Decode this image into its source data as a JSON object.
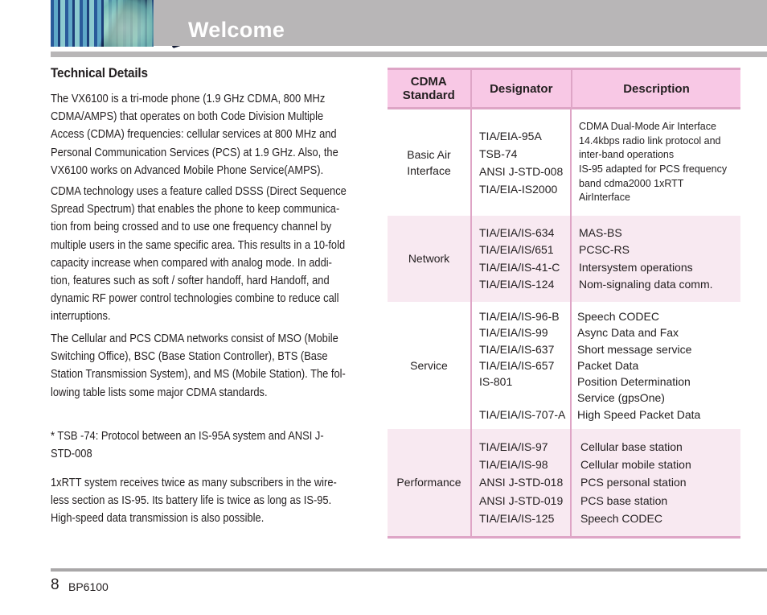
{
  "header": {
    "title": "Welcome",
    "image": "header-photo"
  },
  "content": {
    "section_title": "Technical Details",
    "paragraphs": [
      "The VX6100 is a tri-mode phone (1.9 GHz CDMA, 800 MHz CDMA/AMPS) that operates on both Code Division Multiple Access (CDMA) frequencies: cellular services at 800 MHz and Personal Communication Services (PCS) at 1.9 GHz. Also, the VX6100 works on Advanced Mobile Phone Service(AMPS).",
      "CDMA technology uses a feature called DSSS (Direct Sequence Spread Spectrum) that enables the phone to keep communica-tion from being crossed and to use one frequency channel by multiple users in the same specific area. This results in a 10-fold capacity increase when compared with analog mode. In addi-tion, features such as soft / softer handoff, hard Handoff, and dynamic RF power control technologies combine to reduce call interruptions.",
      "The Cellular and PCS CDMA networks consist of MSO (Mobile Switching Office), BSC (Base Station Controller), BTS (Base Station Transmission System), and MS (Mobile Station). The fol-lowing table lists some major CDMA standards.",
      "*  TSB -74: Protocol between an IS-95A system and ANSI J-STD-008",
      "1xRTT system receives twice as many subscribers in the wire-less section as IS-95. Its battery life is twice as long as IS-95. High-speed data transmission is also possible."
    ],
    "paragraph_lines": [
      [
        "The VX6100 is a tri-mode phone (1.9 GHz CDMA, 800 MHz",
        "CDMA/AMPS) that operates on both Code Division Multiple",
        "Access (CDMA) frequencies: cellular services at 800 MHz and",
        "Personal Communication Services (PCS) at 1.9 GHz. Also, the",
        "VX6100 works on Advanced Mobile Phone Service(AMPS)."
      ],
      [
        "CDMA technology uses a feature called DSSS (Direct Sequence",
        "Spread Spectrum) that enables the phone to keep communica-",
        "tion from being crossed and to use one frequency channel by",
        "multiple users in the same specific area. This results in a 10-fold",
        "capacity increase when compared with analog mode. In addi-",
        "tion, features such as soft / softer handoff, hard Handoff, and",
        "dynamic RF power control technologies combine to reduce call",
        "interruptions."
      ],
      [
        "The Cellular and PCS CDMA networks consist of MSO (Mobile",
        "Switching Office), BSC (Base Station Controller), BTS (Base",
        "Station Transmission System), and MS (Mobile Station). The fol-",
        "lowing table lists some major CDMA standards."
      ],
      [
        "*  TSB -74: Protocol between an IS-95A system and ANSI J-",
        "STD-008"
      ],
      [
        "1xRTT system receives twice as many subscribers in the wire-",
        "less section as IS-95. Its battery life is twice as long as IS-95.",
        "High-speed data transmission is also possible."
      ]
    ]
  },
  "table": {
    "headers": [
      "CDMA Standard",
      "Designator",
      "Description"
    ],
    "header_lines": [
      [
        "CDMA",
        "Standard"
      ],
      [
        "Designator"
      ],
      [
        "Description"
      ]
    ],
    "colors": {
      "header_bg": "#f8c8e5",
      "border": "#dea5c6",
      "alt_row_bg": "#f8e9f1"
    },
    "rows": [
      {
        "standard": [
          "Basic Air",
          "Interface"
        ],
        "designators": [
          "TIA/EIA-95A",
          "TSB-74",
          "ANSI J-STD-008",
          "TIA/EIA-IS2000"
        ],
        "descriptions": [
          "CDMA Dual-Mode Air Interface",
          "14.4kbps radio link protocol and",
          "inter-band operations",
          "IS-95 adapted for PCS frequency",
          "band cdma2000 1xRTT",
          "AirInterface"
        ]
      },
      {
        "standard": [
          "Network"
        ],
        "designators": [
          "TIA/EIA/IS-634",
          "TIA/EIA/IS/651",
          "TIA/EIA/IS-41-C",
          "TIA/EIA/IS-124"
        ],
        "descriptions": [
          "MAS-BS",
          "PCSC-RS",
          "Intersystem operations",
          "Nom-signaling data comm."
        ]
      },
      {
        "standard": [
          "Service"
        ],
        "designators": [
          "TIA/EIA/IS-96-B",
          "TIA/EIA/IS-99",
          "TIA/EIA/IS-637",
          "TIA/EIA/IS-657",
          "IS-801",
          "",
          "TIA/EIA/IS-707-A"
        ],
        "descriptions": [
          "Speech CODEC",
          "Async Data and Fax",
          "Short message service",
          "Packet Data",
          "Position Determination",
          "Service (gpsOne)",
          "High Speed Packet Data"
        ]
      },
      {
        "standard": [
          "Performance"
        ],
        "designators": [
          "TIA/EIA/IS-97",
          "TIA/EIA/IS-98",
          "ANSI J-STD-018",
          "ANSI J-STD-019",
          "TIA/EIA/IS-125"
        ],
        "descriptions": [
          "Cellular base station",
          "Cellular mobile station",
          "PCS personal station",
          "PCS base station",
          "Speech CODEC"
        ]
      }
    ]
  },
  "footer": {
    "page_number": "8",
    "model": "BP6100"
  }
}
